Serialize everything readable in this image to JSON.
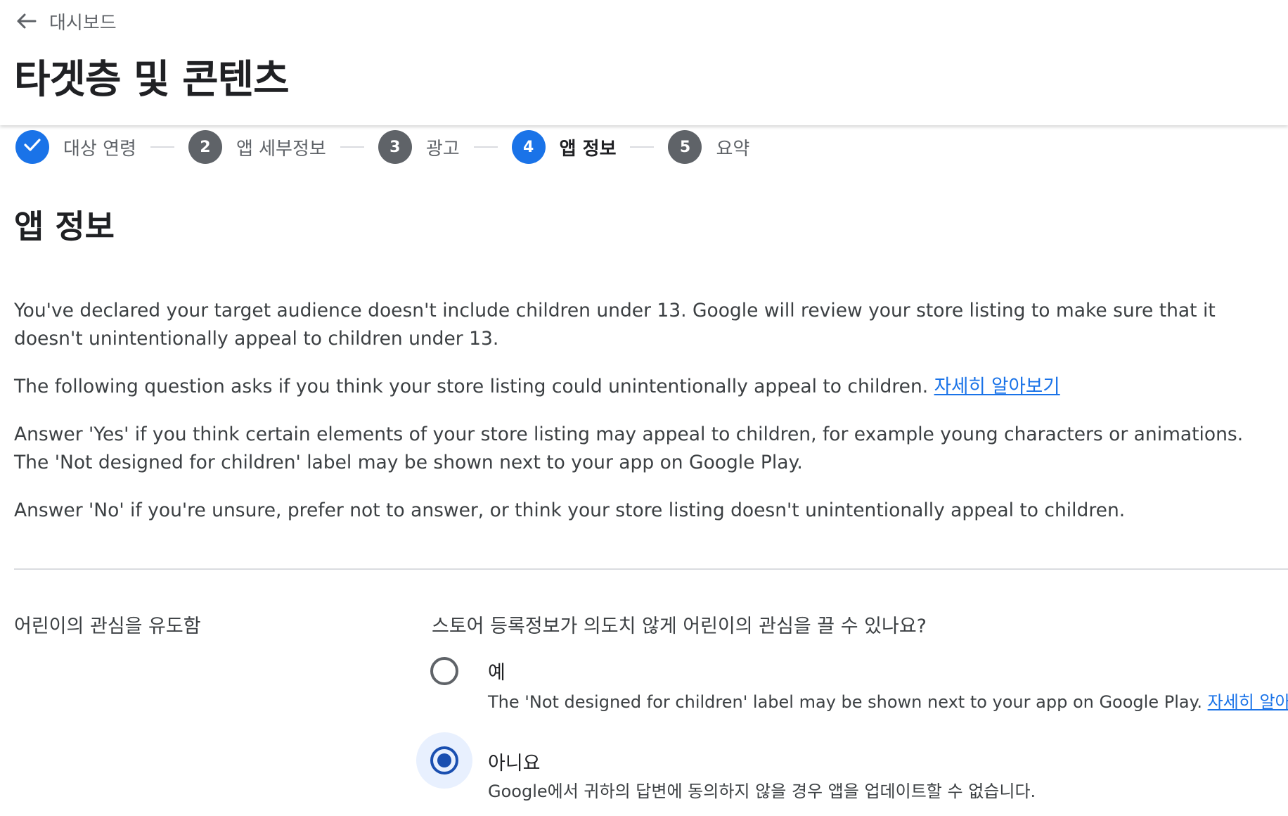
{
  "header": {
    "back_label": "대시보드",
    "title": "타겟층 및 콘텐츠"
  },
  "stepper": [
    {
      "number": "",
      "label": "대상 연령",
      "state": "done"
    },
    {
      "number": "2",
      "label": "앱 세부정보",
      "state": "pending"
    },
    {
      "number": "3",
      "label": "광고",
      "state": "pending"
    },
    {
      "number": "4",
      "label": "앱 정보",
      "state": "active"
    },
    {
      "number": "5",
      "label": "요약",
      "state": "pending"
    }
  ],
  "main": {
    "section_title": "앱 정보",
    "para1": "You've declared your target audience doesn't include children under 13. Google will review your store listing to make sure that it doesn't unintentionally appeal to children under 13.",
    "para2_text": "The following question asks if you think your store listing could unintentionally appeal to children. ",
    "para2_link": "자세히 알아보기",
    "para3": "Answer 'Yes' if you think certain elements of your store listing may appeal to children, for example young characters or animations. The 'Not designed for children' label may be shown next to your app on Google Play.",
    "para4": "Answer 'No' if you're unsure, prefer not to answer, or think your store listing doesn't unintentionally appeal to children.",
    "field_label": "어린이의 관심을 유도함",
    "question": "스토어 등록정보가 의도치 않게 어린이의 관심을 끌 수 있나요?",
    "options": [
      {
        "label": "예",
        "description": "The 'Not designed for children' label may be shown next to your app on Google Play. ",
        "link": "자세히 알아보기",
        "selected": false
      },
      {
        "label": "아니요",
        "description": "Google에서 귀하의 답변에 동의하지 않을 경우 앱을 업데이트할 수 없습니다.",
        "selected": true
      }
    ]
  },
  "colors": {
    "accent": "#1a73e8",
    "selected_radio": "#1a4fb0",
    "step_pending": "#5f6368"
  },
  "icons": {
    "back": "arrow-left-icon",
    "done": "check-icon"
  }
}
